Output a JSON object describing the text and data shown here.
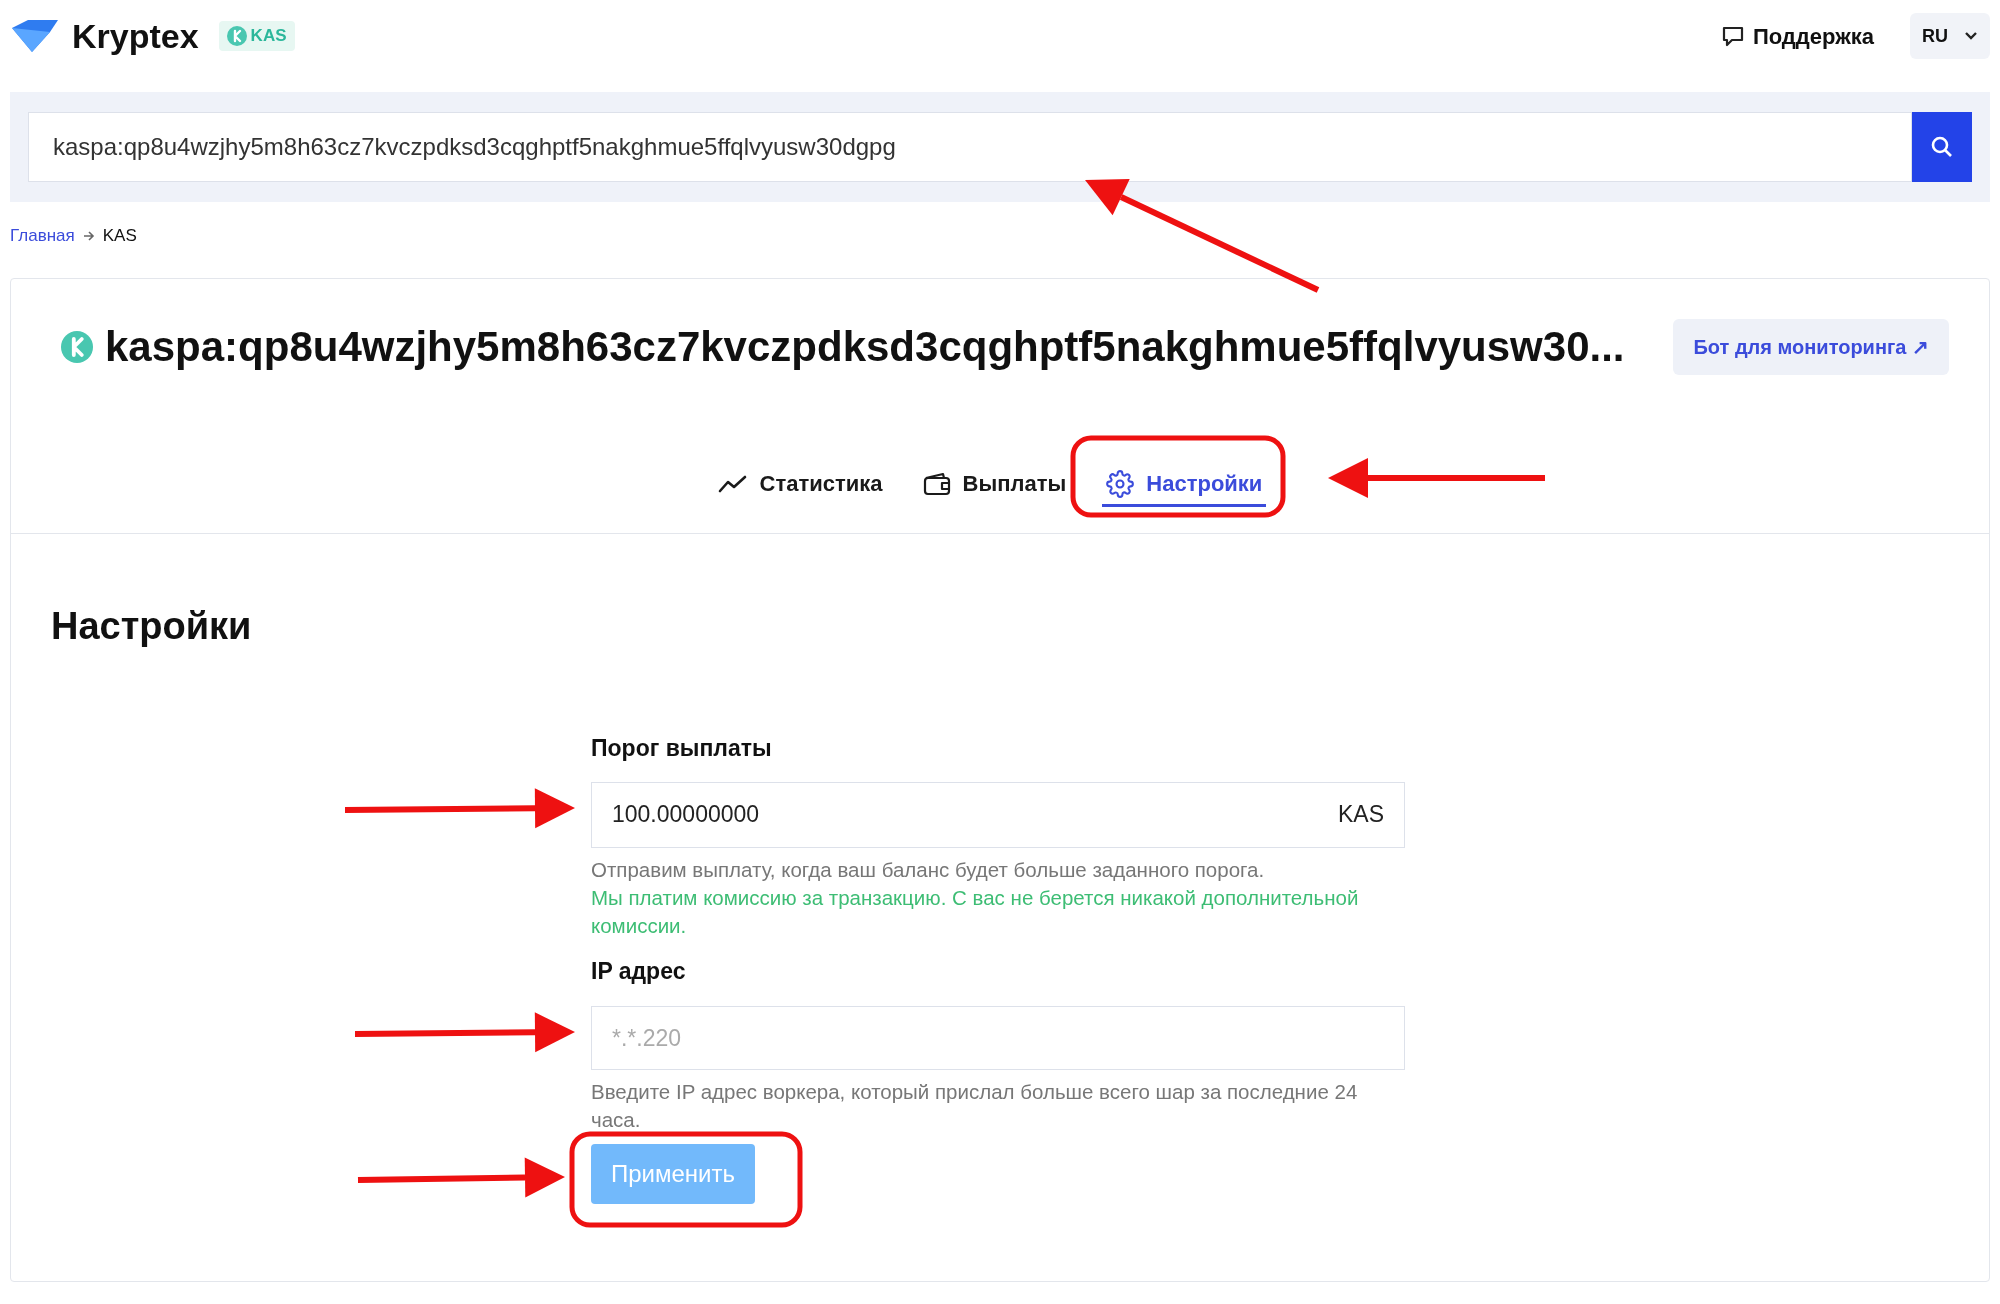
{
  "header": {
    "brand": "Kryptex",
    "coin_badge": "KAS",
    "support": "Поддержка",
    "language": "RU"
  },
  "search": {
    "value": "kaspa:qp8u4wzjhy5m8h63cz7kvczpdksd3cqghptf5nakghmue5ffqlvyusw30dgpg"
  },
  "breadcrumbs": [
    {
      "label": "Главная",
      "kind": "link"
    },
    {
      "label": "KAS",
      "kind": "current"
    }
  ],
  "wallet": {
    "title": "kaspa:qp8u4wzjhy5m8h63cz7kvczpdksd3cqghptf5nakghmue5ffqlvyusw30...",
    "bot_button": "Бот для мониторинга ↗"
  },
  "tabs": [
    {
      "label": "Статистика",
      "kind": "chart",
      "selected": false
    },
    {
      "label": "Выплаты",
      "kind": "wallet",
      "selected": false
    },
    {
      "label": "Настройки",
      "kind": "gear",
      "selected": true
    }
  ],
  "settings": {
    "heading": "Настройки",
    "threshold": {
      "label": "Порог выплаты",
      "value": "100.00000000",
      "unit": "KAS",
      "hint": "Отправим выплату, когда ваш баланс будет больше заданного порога.",
      "note": "Мы платим комиссию за транзакцию. С вас не берется никакой дополнительной комиссии."
    },
    "ip": {
      "label": "IP адрес",
      "placeholder": "*.*.220",
      "hint": "Введите IP адрес воркера, который прислал больше всего шар за последние 24 часа."
    },
    "apply_button": {
      "label": "Применить",
      "disabled": true
    }
  }
}
